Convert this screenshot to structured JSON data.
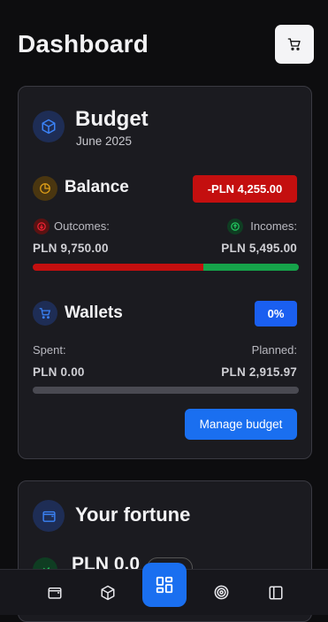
{
  "header": {
    "title": "Dashboard"
  },
  "budget": {
    "title": "Budget",
    "period": "June 2025",
    "balance": {
      "title": "Balance",
      "value": "-PLN 4,255.00",
      "outcomes_label": "Outcomes:",
      "outcomes_value": "PLN 9,750.00",
      "incomes_label": "Incomes:",
      "incomes_value": "PLN 5,495.00",
      "outcomes_share": 0.64
    },
    "wallets": {
      "title": "Wallets",
      "percent": "0%",
      "spent_label": "Spent:",
      "spent_value": "PLN 0.00",
      "planned_label": "Planned:",
      "planned_value": "PLN 2,915.97",
      "progress": 0
    },
    "manage_button": "Manage budget"
  },
  "fortune": {
    "title": "Your fortune",
    "value": "PLN 0.0"
  },
  "nav": {
    "items": [
      "wallet-icon",
      "box-icon",
      "dashboard-icon",
      "target-icon",
      "sidebar-icon"
    ],
    "active": "dashboard-icon"
  },
  "colors": {
    "accent": "#1a6ff0",
    "negative": "#cc1111",
    "positive": "#16a34a",
    "track": "#4a4a52"
  }
}
